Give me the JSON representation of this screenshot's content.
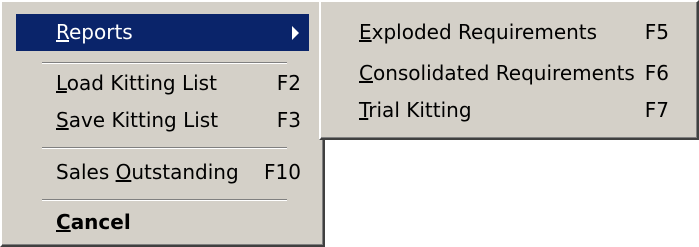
{
  "main_menu": {
    "reports": {
      "pre": "",
      "acc": "R",
      "post": "eports"
    },
    "load_kitting_list": {
      "pre": "",
      "acc": "L",
      "post": "oad Kitting List",
      "shortcut": "F2"
    },
    "save_kitting_list": {
      "pre": "",
      "acc": "S",
      "post": "ave Kitting List",
      "shortcut": "F3"
    },
    "sales_outstanding": {
      "pre": "Sales ",
      "acc": "O",
      "post": "utstanding",
      "shortcut": "F10"
    },
    "cancel": {
      "pre": "",
      "acc": "C",
      "post": "ancel"
    }
  },
  "reports_submenu": {
    "exploded_requirements": {
      "pre": "",
      "acc": "E",
      "post": "xploded Requirements",
      "shortcut": "F5"
    },
    "consolidated_requirements": {
      "pre": "",
      "acc": "C",
      "post": "onsolidated Requirements",
      "shortcut": "F6"
    },
    "trial_kitting": {
      "pre": "",
      "acc": "T",
      "post": "rial Kitting",
      "shortcut": "F7"
    }
  },
  "colors": {
    "menu_background": "#d4d0c8",
    "selection_background": "#0a246a",
    "selection_text": "#ffffff"
  },
  "icons": {
    "submenu_arrow": "submenu-arrow-icon"
  }
}
